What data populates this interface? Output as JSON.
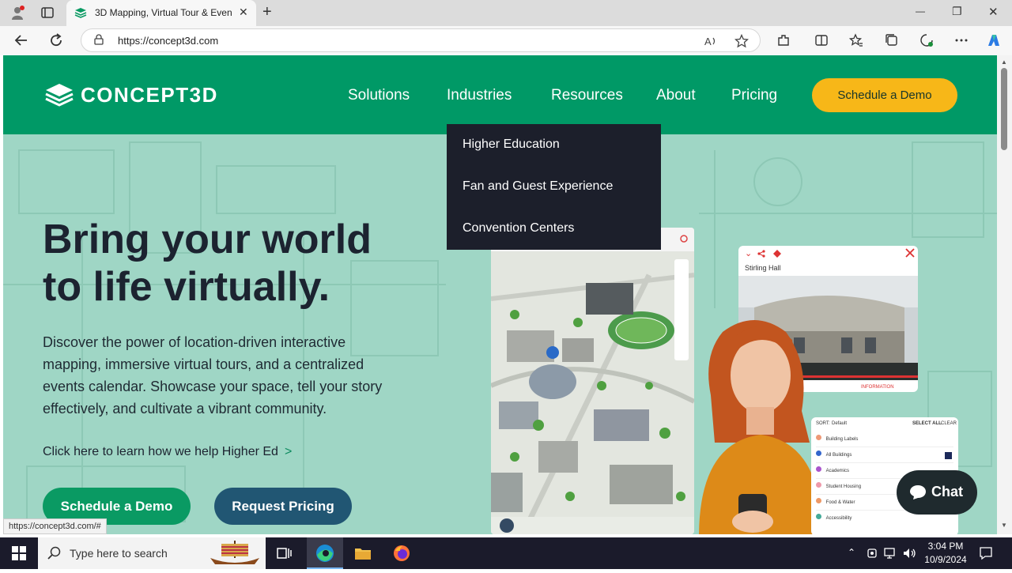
{
  "browser": {
    "tab_title": "3D Mapping, Virtual Tour & Even",
    "tab_close": "✕",
    "new_tab": "+",
    "url": "https://concept3d.com",
    "win_min": "—",
    "win_max": "❐",
    "win_close": "✕"
  },
  "site": {
    "logo": "CONCEPT3D",
    "nav": [
      "Solutions",
      "Industries",
      "Resources",
      "About",
      "Pricing"
    ],
    "schedule_demo": "Schedule a Demo",
    "dropdown": [
      "Higher Education",
      "Fan and Guest Experience",
      "Convention Centers"
    ],
    "headline_line1": "Bring your world",
    "headline_line2": "to life virtually.",
    "subtext": "Discover the power of location-driven interactive mapping, immersive virtual tours, and a centralized events calendar. Showcase your space, tell your story effectively, and cultivate a vibrant community.",
    "learn_link": "Click here to learn how we help Higher Ed",
    "learn_chevron": ">",
    "hero_demo": "Schedule a Demo",
    "hero_pricing": "Request Pricing",
    "info_title": "Stirling Hall",
    "info_label": "INFORMATION",
    "filter": {
      "sort": "SORT:",
      "sort_value": "Default",
      "select_all": "SELECT ALL",
      "clear": "CLEAR",
      "items": [
        "Building Labels",
        "All Buildings",
        "Academics",
        "Student Housing",
        "Food & Water",
        "Accessibility"
      ]
    },
    "chat": "Chat",
    "status_url": "https://concept3d.com/#"
  },
  "taskbar": {
    "search_placeholder": "Type here to search",
    "time": "3:04 PM",
    "date": "10/9/2024"
  },
  "colors": {
    "brand_green": "#009966",
    "accent_yellow": "#f7b718",
    "pricing_blue": "#215673",
    "dropdown_bg": "#1c1f2b"
  }
}
